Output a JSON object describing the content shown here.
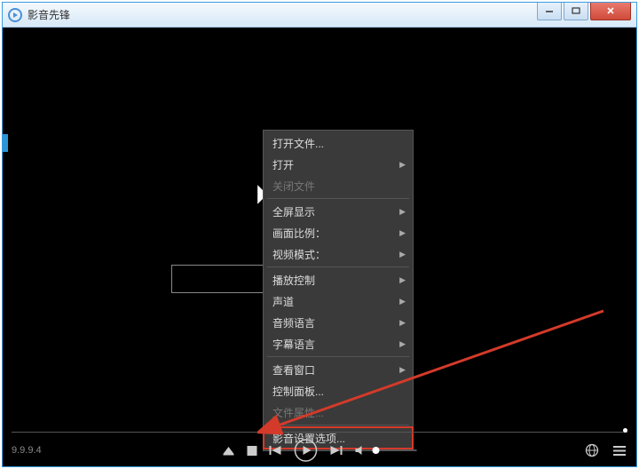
{
  "window": {
    "title": "影音先锋"
  },
  "menu": {
    "open_file": "打开文件...",
    "open": "打开",
    "close_file": "关闭文件",
    "fullscreen": "全屏显示",
    "aspect_ratio": "画面比例：",
    "video_mode": "视频模式：",
    "playback_ctrl": "播放控制",
    "audio_track": "声道",
    "audio_lang": "音频语言",
    "subtitle_lang": "字幕语言",
    "view_window": "查看窗口",
    "control_panel": "控制面板...",
    "file_props": "文件属性...",
    "av_settings": "影音设置选项..."
  },
  "footer": {
    "version": "9.9.9.4"
  }
}
